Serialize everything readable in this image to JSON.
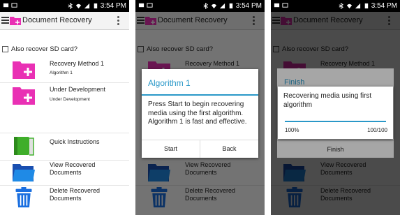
{
  "status_bar": {
    "time": "3:54 PM"
  },
  "app_bar": {
    "title": "Document Recovery"
  },
  "main": {
    "sd_checkbox_label": "Also recover SD card?",
    "items": [
      {
        "title": "Recovery Method 1",
        "subtitle": "Algorithm 1",
        "icon": "folder-plus-icon"
      },
      {
        "title": "Under Development",
        "subtitle": "Under Development",
        "icon": "folder-plus-icon"
      },
      {
        "title": "Quick Instructions",
        "icon": "book-icon"
      },
      {
        "title": "View Recovered\nDocuments",
        "icon": "folder-icon"
      },
      {
        "title": "Delete Recovered\nDocuments",
        "icon": "trash-icon"
      }
    ]
  },
  "dialog_algorithm": {
    "title": "Algorithm 1",
    "message": "Press Start to begin recovering media using the first algorithm. Algorithm 1 is fast and effective.",
    "start_label": "Start",
    "back_label": "Back"
  },
  "dialog_progress": {
    "behind_title": "Finish",
    "behind_button": "Finish",
    "message": "Recovering media using first algorithm",
    "percent": "100%",
    "count": "100/100",
    "progress": 1.0
  },
  "colors": {
    "accent": "#2a98c8",
    "folder_pink": "#e930b4",
    "book_green": "#3fae2a",
    "folder_blue": "#1f63d6",
    "trash_blue": "#1a6fe0"
  }
}
